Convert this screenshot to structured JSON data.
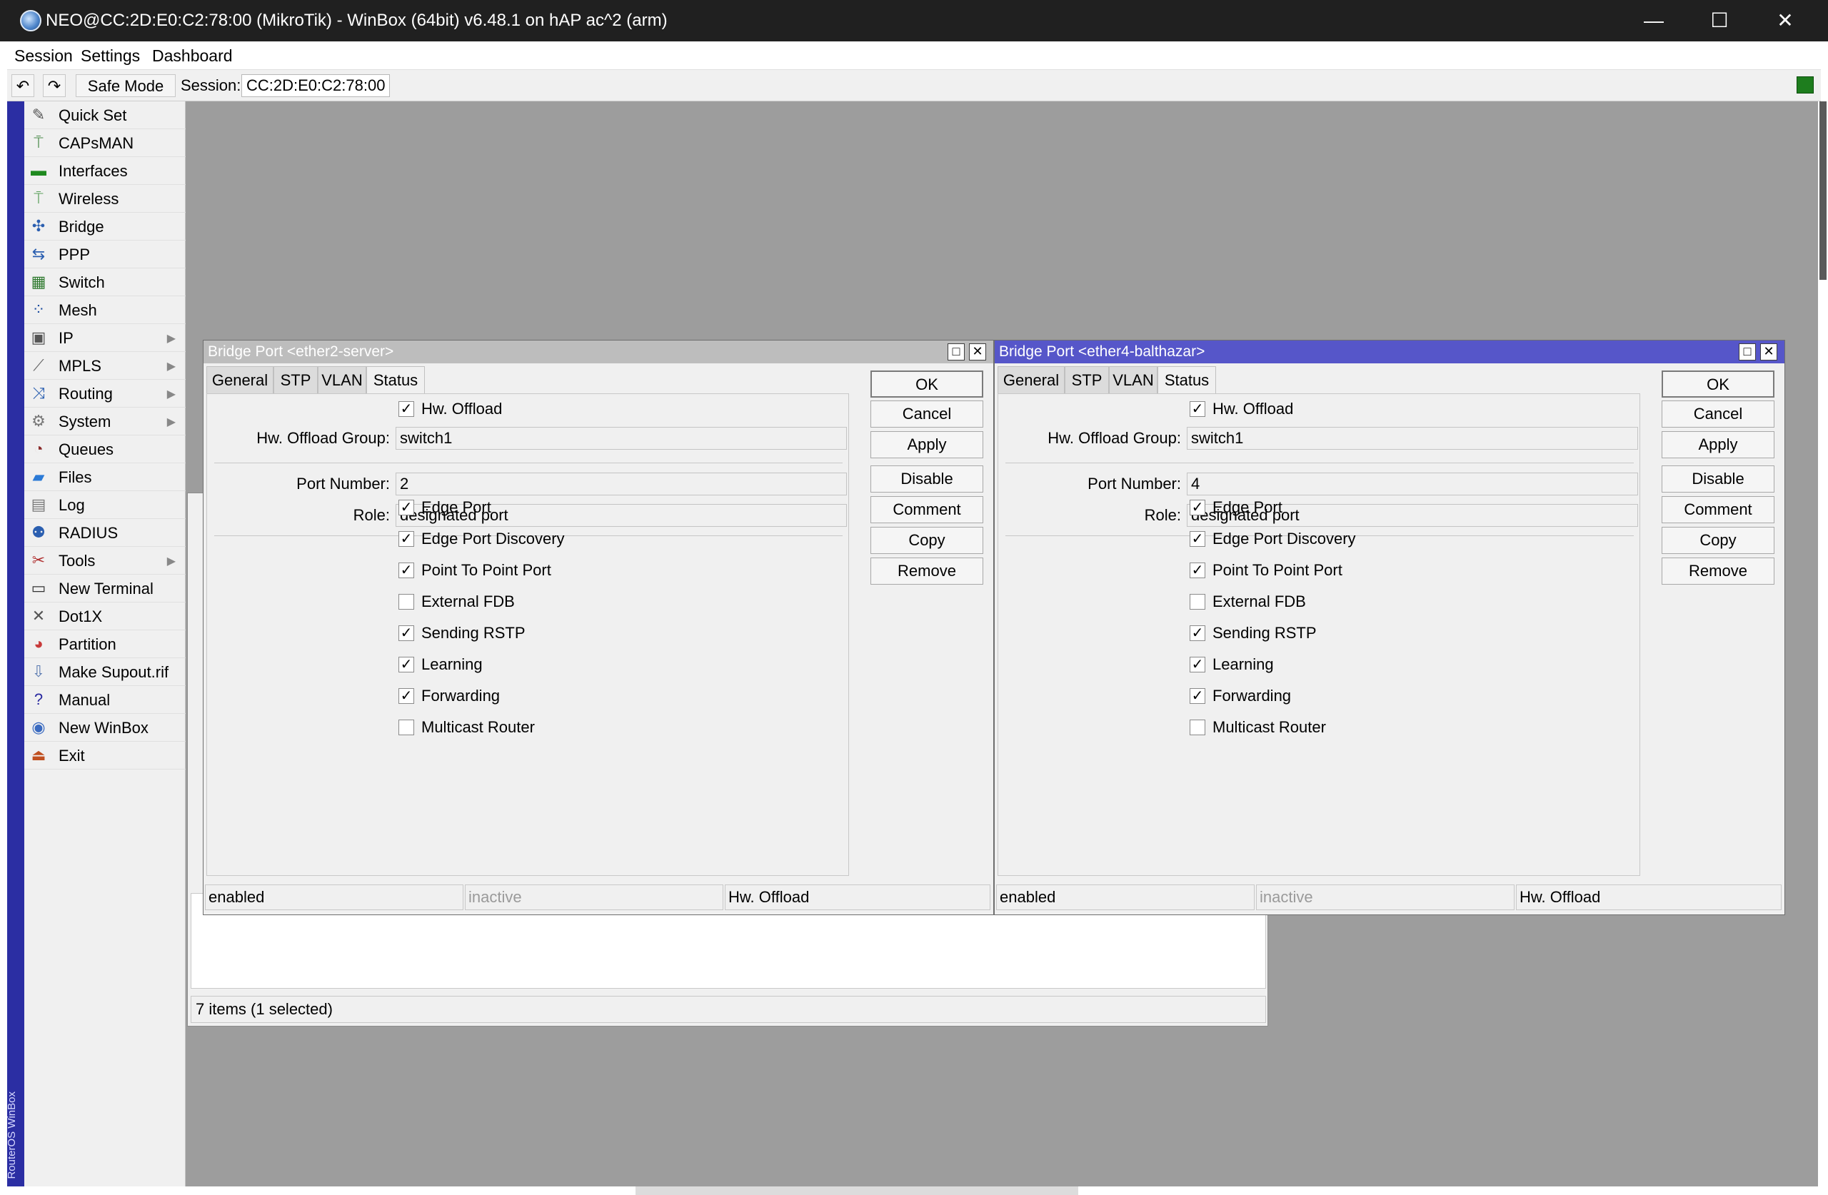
{
  "window": {
    "title": "NEO@CC:2D:E0:C2:78:00 (MikroTik) - WinBox (64bit) v6.48.1 on hAP ac^2 (arm)",
    "minimize": "—",
    "maximize": "☐",
    "close": "✕"
  },
  "menu": {
    "items": [
      "Session",
      "Settings",
      "Dashboard"
    ]
  },
  "toolbar": {
    "undo": "↶",
    "redo": "↷",
    "safe_mode": "Safe Mode",
    "session_label": "Session:",
    "session_value": "CC:2D:E0:C2:78:00",
    "led_color": "#1e7d1e"
  },
  "brand_strip": {
    "text": "RouterOS WinBox",
    "color": "#2b2ea3"
  },
  "sidebar": {
    "items": [
      {
        "label": "Quick Set",
        "icon": "wand-icon",
        "glyph": "✎",
        "color": "#555555",
        "submenu": false
      },
      {
        "label": "CAPsMAN",
        "icon": "antenna-icon",
        "glyph": "⍑",
        "color": "#4a8a4a",
        "submenu": false
      },
      {
        "label": "Interfaces",
        "icon": "ethernet-card-icon",
        "glyph": "▬",
        "color": "#1f8a1f",
        "submenu": false
      },
      {
        "label": "Wireless",
        "icon": "wireless-icon",
        "glyph": "⍑",
        "color": "#5aa05a",
        "submenu": false
      },
      {
        "label": "Bridge",
        "icon": "bridge-icon",
        "glyph": "✣",
        "color": "#2b5fb0",
        "submenu": false
      },
      {
        "label": "PPP",
        "icon": "ppp-icon",
        "glyph": "⇆",
        "color": "#2b5fb0",
        "submenu": false
      },
      {
        "label": "Switch",
        "icon": "switch-icon",
        "glyph": "▦",
        "color": "#2f7a2f",
        "submenu": false
      },
      {
        "label": "Mesh",
        "icon": "mesh-icon",
        "glyph": "⁘",
        "color": "#1e4ea0",
        "submenu": false
      },
      {
        "label": "IP",
        "icon": "ip-icon",
        "glyph": "▣",
        "color": "#555555",
        "submenu": true
      },
      {
        "label": "MPLS",
        "icon": "mpls-icon",
        "glyph": "⟋",
        "color": "#666666",
        "submenu": true
      },
      {
        "label": "Routing",
        "icon": "routing-icon",
        "glyph": "⤨",
        "color": "#2b5fb0",
        "submenu": true
      },
      {
        "label": "System",
        "icon": "gear-icon",
        "glyph": "⚙",
        "color": "#777777",
        "submenu": true
      },
      {
        "label": "Queues",
        "icon": "queues-icon",
        "glyph": "◔",
        "color": "#8a2a2a",
        "submenu": false
      },
      {
        "label": "Files",
        "icon": "folder-icon",
        "glyph": "▰",
        "color": "#2b7ad6",
        "submenu": false
      },
      {
        "label": "Log",
        "icon": "log-icon",
        "glyph": "▤",
        "color": "#777777",
        "submenu": false
      },
      {
        "label": "RADIUS",
        "icon": "users-icon",
        "glyph": "⚉",
        "color": "#2b5fb0",
        "submenu": false
      },
      {
        "label": "Tools",
        "icon": "tools-icon",
        "glyph": "✂",
        "color": "#b03030",
        "submenu": true
      },
      {
        "label": "New Terminal",
        "icon": "terminal-icon",
        "glyph": "▭",
        "color": "#333333",
        "submenu": false
      },
      {
        "label": "Dot1X",
        "icon": "dot1x-icon",
        "glyph": "✕",
        "color": "#555555",
        "submenu": false
      },
      {
        "label": "Partition",
        "icon": "partition-icon",
        "glyph": "◕",
        "color": "#c83a3a",
        "submenu": false
      },
      {
        "label": "Make Supout.rif",
        "icon": "supout-icon",
        "glyph": "⇩",
        "color": "#5a7ab0",
        "submenu": false
      },
      {
        "label": "Manual",
        "icon": "manual-icon",
        "glyph": "?",
        "color": "#2a2aa0",
        "submenu": false
      },
      {
        "label": "New WinBox",
        "icon": "winbox-icon",
        "glyph": "◉",
        "color": "#3a6ac0",
        "submenu": false
      },
      {
        "label": "Exit",
        "icon": "exit-icon",
        "glyph": "⏏",
        "color": "#c05020",
        "submenu": false
      }
    ]
  },
  "background_list": {
    "status": "7 items (1 selected)"
  },
  "bridge_ports": [
    {
      "title": "Bridge Port <ether2-server>",
      "active": false,
      "tabs": [
        "General",
        "STP",
        "VLAN",
        "Status"
      ],
      "selected_tab": "Status",
      "hw_offload": {
        "label": "Hw. Offload",
        "checked": true
      },
      "hw_offload_group": {
        "label": "Hw. Offload Group:",
        "value": "switch1"
      },
      "port_number": {
        "label": "Port Number:",
        "value": "2"
      },
      "role": {
        "label": "Role:",
        "value": "designated port"
      },
      "flags": [
        {
          "label": "Edge Port",
          "checked": true
        },
        {
          "label": "Edge Port Discovery",
          "checked": true
        },
        {
          "label": "Point To Point Port",
          "checked": true
        },
        {
          "label": "External FDB",
          "checked": false
        },
        {
          "label": "Sending RSTP",
          "checked": true
        },
        {
          "label": "Learning",
          "checked": true
        },
        {
          "label": "Forwarding",
          "checked": true
        },
        {
          "label": "Multicast Router",
          "checked": false
        }
      ],
      "buttons": [
        "OK",
        "Cancel",
        "Apply",
        "Disable",
        "Comment",
        "Copy",
        "Remove"
      ],
      "status": [
        "enabled",
        "inactive",
        "Hw. Offload"
      ]
    },
    {
      "title": "Bridge Port <ether4-balthazar>",
      "active": true,
      "tabs": [
        "General",
        "STP",
        "VLAN",
        "Status"
      ],
      "selected_tab": "Status",
      "hw_offload": {
        "label": "Hw. Offload",
        "checked": true
      },
      "hw_offload_group": {
        "label": "Hw. Offload Group:",
        "value": "switch1"
      },
      "port_number": {
        "label": "Port Number:",
        "value": "4"
      },
      "role": {
        "label": "Role:",
        "value": "designated port"
      },
      "flags": [
        {
          "label": "Edge Port",
          "checked": true
        },
        {
          "label": "Edge Port Discovery",
          "checked": true
        },
        {
          "label": "Point To Point Port",
          "checked": true
        },
        {
          "label": "External FDB",
          "checked": false
        },
        {
          "label": "Sending RSTP",
          "checked": true
        },
        {
          "label": "Learning",
          "checked": true
        },
        {
          "label": "Forwarding",
          "checked": true
        },
        {
          "label": "Multicast Router",
          "checked": false
        }
      ],
      "buttons": [
        "OK",
        "Cancel",
        "Apply",
        "Disable",
        "Comment",
        "Copy",
        "Remove"
      ],
      "status": [
        "enabled",
        "inactive",
        "Hw. Offload"
      ]
    }
  ],
  "window_buttons": {
    "maximize": "□",
    "close": "✕"
  },
  "colors": {
    "active_title": "#5656c9",
    "inactive_title": "#bdbdbd",
    "workspace": "#9d9d9d"
  }
}
